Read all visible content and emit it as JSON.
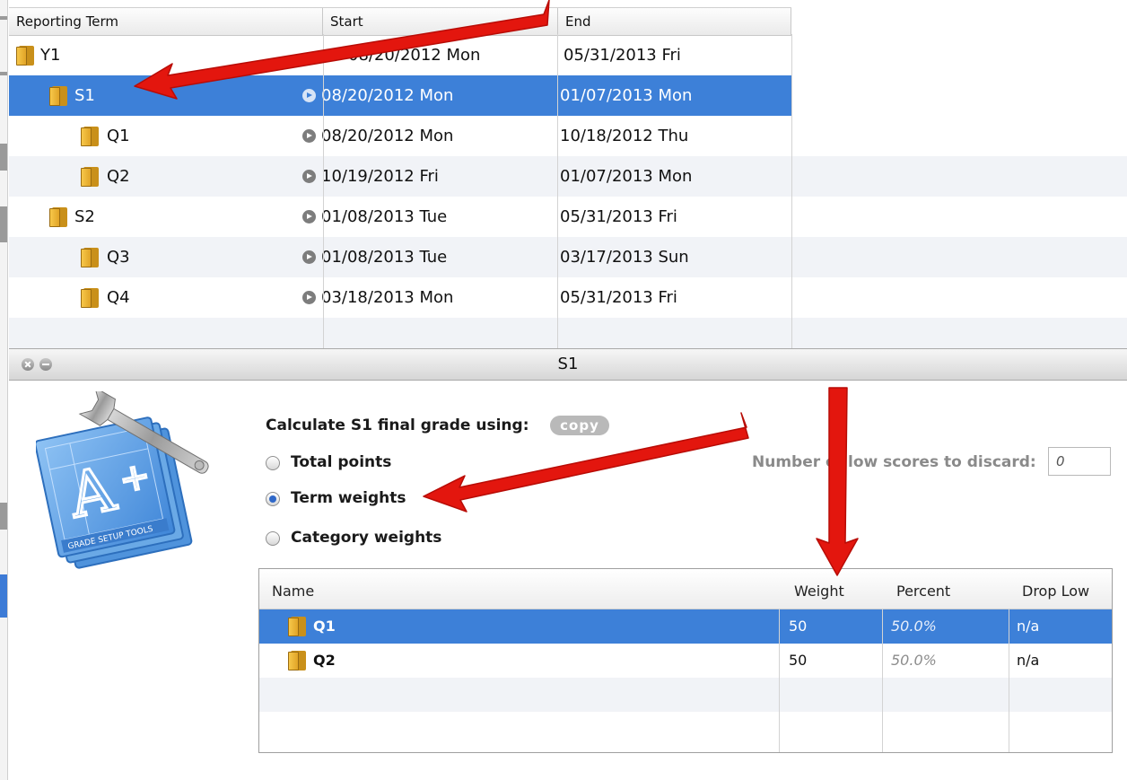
{
  "terms_table": {
    "headers": {
      "term": "Reporting Term",
      "start": "Start",
      "end": "End"
    },
    "rows": [
      {
        "name": "Y1",
        "start": "08/20/2012 Mon",
        "end": "05/31/2013 Fri",
        "level": 0
      },
      {
        "name": "S1",
        "start": "08/20/2012 Mon",
        "end": "01/07/2013 Mon",
        "level": 1,
        "selected": true
      },
      {
        "name": "Q1",
        "start": "08/20/2012 Mon",
        "end": "10/18/2012 Thu",
        "level": 2
      },
      {
        "name": "Q2",
        "start": "10/19/2012 Fri",
        "end": "01/07/2013 Mon",
        "level": 2
      },
      {
        "name": "S2",
        "start": "01/08/2013 Tue",
        "end": "05/31/2013 Fri",
        "level": 1
      },
      {
        "name": "Q3",
        "start": "01/08/2013 Tue",
        "end": "03/17/2013 Sun",
        "level": 2
      },
      {
        "name": "Q4",
        "start": "03/18/2013 Mon",
        "end": "05/31/2013 Fri",
        "level": 2
      }
    ]
  },
  "inspector": {
    "title": "S1",
    "calculate_label": "Calculate S1 final grade using:",
    "copy_label": "copy",
    "options": {
      "total_points": "Total points",
      "term_weights": "Term weights",
      "category_weights": "Category weights"
    },
    "selected_option": "term_weights",
    "discard_label": "Number of low scores to discard:",
    "discard_value": "0",
    "icon_caption": "GRADE SETUP TOOLS"
  },
  "weights_table": {
    "headers": {
      "name": "Name",
      "weight": "Weight",
      "percent": "Percent",
      "drop_low": "Drop Low"
    },
    "rows": [
      {
        "name": "Q1",
        "weight": "50",
        "percent": "50.0%",
        "drop_low": "n/a",
        "selected": true
      },
      {
        "name": "Q2",
        "weight": "50",
        "percent": "50.0%",
        "drop_low": "n/a"
      }
    ]
  },
  "colors": {
    "selection": "#3d80d8",
    "arrow": "#e3160e",
    "folder": "#e8ad2c"
  }
}
